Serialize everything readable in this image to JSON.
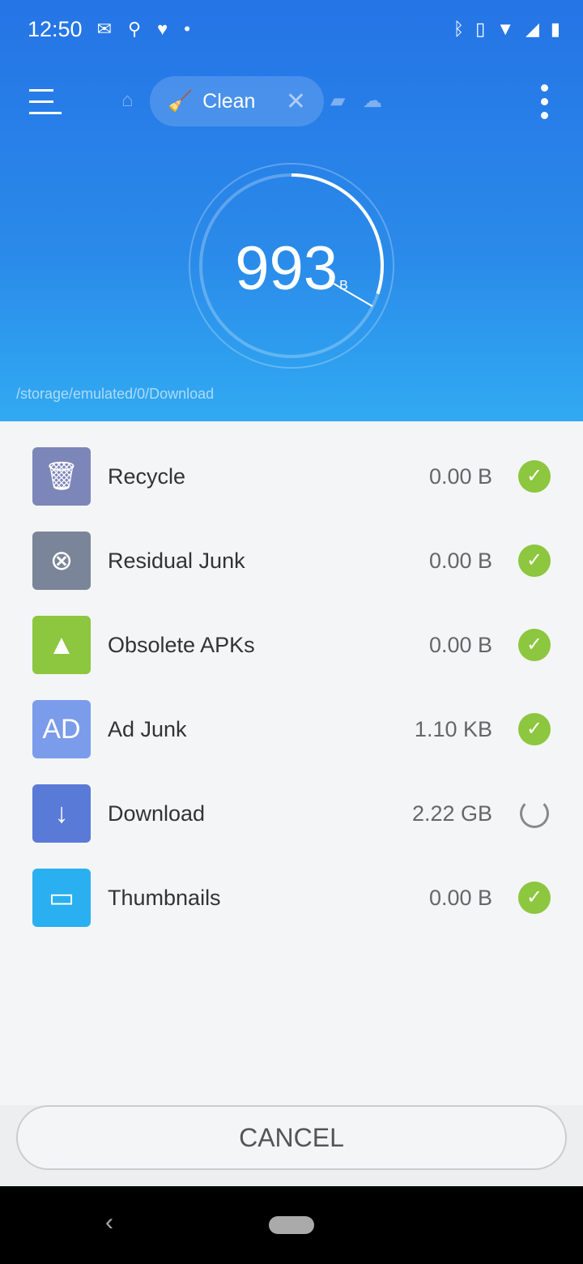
{
  "status": {
    "time": "12:50"
  },
  "toolbar": {
    "tab_label": "Clean"
  },
  "gauge": {
    "value": "993",
    "unit": "B",
    "progress": 0.3
  },
  "path": "/storage/emulated/0/Download",
  "items": [
    {
      "label": "Recycle",
      "size": "0.00 B",
      "state": "done",
      "icon": "trash-icon",
      "color": "#7d86b8"
    },
    {
      "label": "Residual Junk",
      "size": "0.00 B",
      "state": "done",
      "icon": "x-circle-icon",
      "color": "#7b8599"
    },
    {
      "label": "Obsolete APKs",
      "size": "0.00 B",
      "state": "done",
      "icon": "android-icon",
      "color": "#8dc63f"
    },
    {
      "label": "Ad Junk",
      "size": "1.10 KB",
      "state": "done",
      "icon": "ad-folder-icon",
      "color": "#7b9cea"
    },
    {
      "label": "Download",
      "size": "2.22 GB",
      "state": "scanning",
      "icon": "download-icon",
      "color": "#5a7ad8"
    },
    {
      "label": "Thumbnails",
      "size": "0.00 B",
      "state": "done",
      "icon": "image-icon",
      "color": "#2ab0f0"
    }
  ],
  "cancel_label": "CANCEL"
}
